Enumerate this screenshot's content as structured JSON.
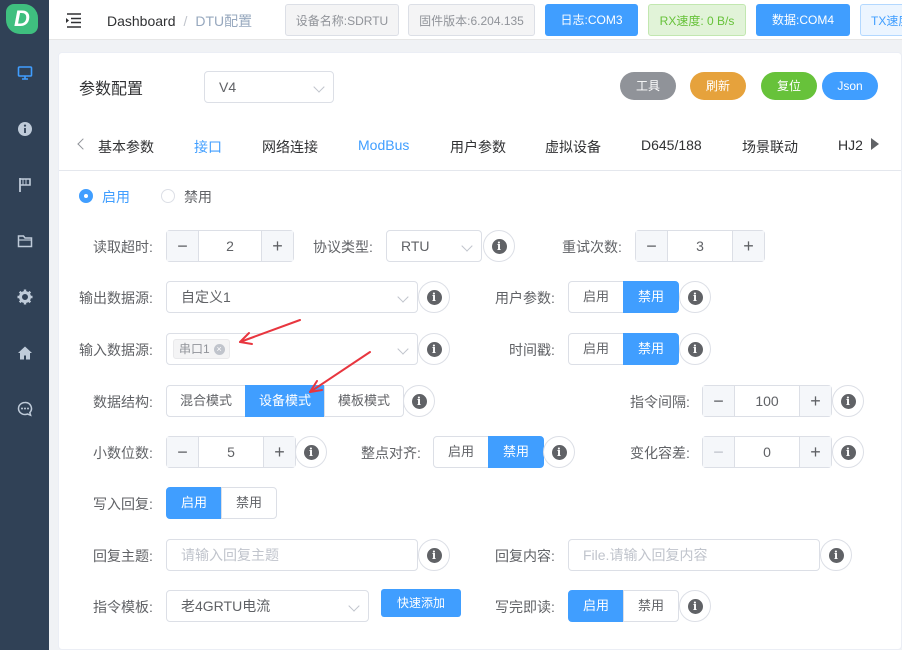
{
  "sidebar": {
    "logo_letter": "D",
    "items": [
      "monitor-icon",
      "info-icon",
      "flag-icon",
      "folder-icon",
      "gear-icon",
      "home-icon",
      "chat-icon"
    ]
  },
  "topbar": {
    "breadcrumb_home": "Dashboard",
    "breadcrumb_sep": "/",
    "breadcrumb_current": "DTU配置",
    "device_name": "设备名称:SDRTU",
    "firmware": "固件版本:6.204.135",
    "log_port": "日志:COM3",
    "rx_speed": "RX速度: 0 B/s",
    "data_port": "数据:COM4",
    "tx_speed": "TX速度"
  },
  "panel": {
    "title": "参数配置",
    "version": "V4",
    "btn_tools": "工具",
    "btn_refresh": "刷新",
    "btn_reset": "复位",
    "btn_json": "Json"
  },
  "tabs": [
    "基本参数",
    "接口",
    "网络连接",
    "ModBus",
    "用户参数",
    "虚拟设备",
    "D645/188",
    "场景联动",
    "HJ2"
  ],
  "active_tab": "ModBus",
  "enable": {
    "on": "启用",
    "off": "禁用",
    "selected": "启用"
  },
  "form": {
    "read_timeout": {
      "label": "读取超时:",
      "value": "2"
    },
    "protocol": {
      "label": "协议类型:",
      "value": "RTU"
    },
    "retry": {
      "label": "重试次数:",
      "value": "3"
    },
    "output_src": {
      "label": "输出数据源:",
      "value": "自定义1"
    },
    "user_param": {
      "label": "用户参数:",
      "on": "启用",
      "off": "禁用",
      "selected": "禁用"
    },
    "input_src": {
      "label": "输入数据源:",
      "tag": "串口1"
    },
    "timestamp": {
      "label": "时间戳:",
      "on": "启用",
      "off": "禁用",
      "selected": "禁用"
    },
    "data_struct": {
      "label": "数据结构:",
      "options": [
        "混合模式",
        "设备模式",
        "模板模式"
      ],
      "selected": "设备模式"
    },
    "cmd_interval": {
      "label": "指令间隔:",
      "value": "100"
    },
    "decimals": {
      "label": "小数位数:",
      "value": "5"
    },
    "align": {
      "label": "整点对齐:",
      "on": "启用",
      "off": "禁用",
      "selected": "禁用"
    },
    "tolerance": {
      "label": "变化容差:",
      "value": "0"
    },
    "write_reply": {
      "label": "写入回复:",
      "on": "启用",
      "off": "禁用",
      "selected": "启用"
    },
    "reply_topic": {
      "label": "回复主题:",
      "placeholder": "请输入回复主题"
    },
    "reply_content": {
      "label": "回复内容:",
      "placeholder": "File.请输入回复内容"
    },
    "cmd_template": {
      "label": "指令模板:",
      "value": "老4GRTU电流",
      "quick_add": "快速添加"
    },
    "read_after_write": {
      "label": "写完即读:",
      "on": "启用",
      "off": "禁用",
      "selected": "启用"
    }
  },
  "colors": {
    "primary": "#409eff",
    "sidebar": "#304156",
    "tools": "#909399",
    "refresh": "#e6a23c",
    "reset": "#67c23a",
    "annotation_arrow": "#e8363f"
  }
}
